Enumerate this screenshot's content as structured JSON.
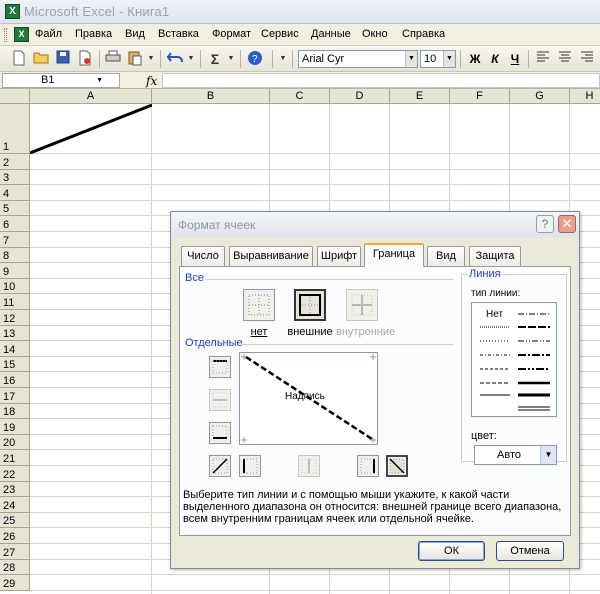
{
  "window": {
    "title": "Microsoft Excel - Книга1",
    "icon": "excel-icon"
  },
  "menu": [
    "Файл",
    "Правка",
    "Вид",
    "Вставка",
    "Формат",
    "Сервис",
    "Данные",
    "Окно",
    "Справка"
  ],
  "toolbar": {
    "font_name": "Arial Cyr",
    "font_size": "10",
    "bold_label": "Ж",
    "italic_label": "К",
    "underline_label": "Ч"
  },
  "formula_bar": {
    "name_box": "B1",
    "fx_label": "fx",
    "formula": ""
  },
  "sheet": {
    "columns": [
      "A",
      "B",
      "C",
      "D",
      "E",
      "F",
      "G",
      "H"
    ],
    "rows": [
      "1",
      "2",
      "3",
      "4",
      "5",
      "6",
      "7",
      "8",
      "9",
      "10",
      "11",
      "12",
      "13",
      "14",
      "15",
      "16",
      "17",
      "18",
      "19",
      "20",
      "21",
      "22",
      "23",
      "24",
      "25",
      "26",
      "27",
      "28",
      "29"
    ]
  },
  "dialog": {
    "title": "Формат ячеек",
    "help_label": "?",
    "close_label": "✕",
    "tabs": [
      "Число",
      "Выравнивание",
      "Шрифт",
      "Граница",
      "Вид",
      "Защита"
    ],
    "active_tab": "Граница",
    "all_group_label": "Все",
    "presets": [
      "нет",
      "внешние",
      "внутренние"
    ],
    "separate_group_label": "Отдельные",
    "preview_text": "Надпись",
    "line_group_label": "Линия",
    "line_type_label": "тип линии:",
    "line_none_label": "Нет",
    "color_label": "цвет:",
    "color_value": "Авто",
    "hint": "Выберите тип линии и с помощью мыши укажите, к какой части выделенного диапазона он относится: внешней границе всего диапазона, всем внутренним границам ячеек или отдельной ячейке.",
    "ok_label": "ОК",
    "cancel_label": "Отмена"
  }
}
